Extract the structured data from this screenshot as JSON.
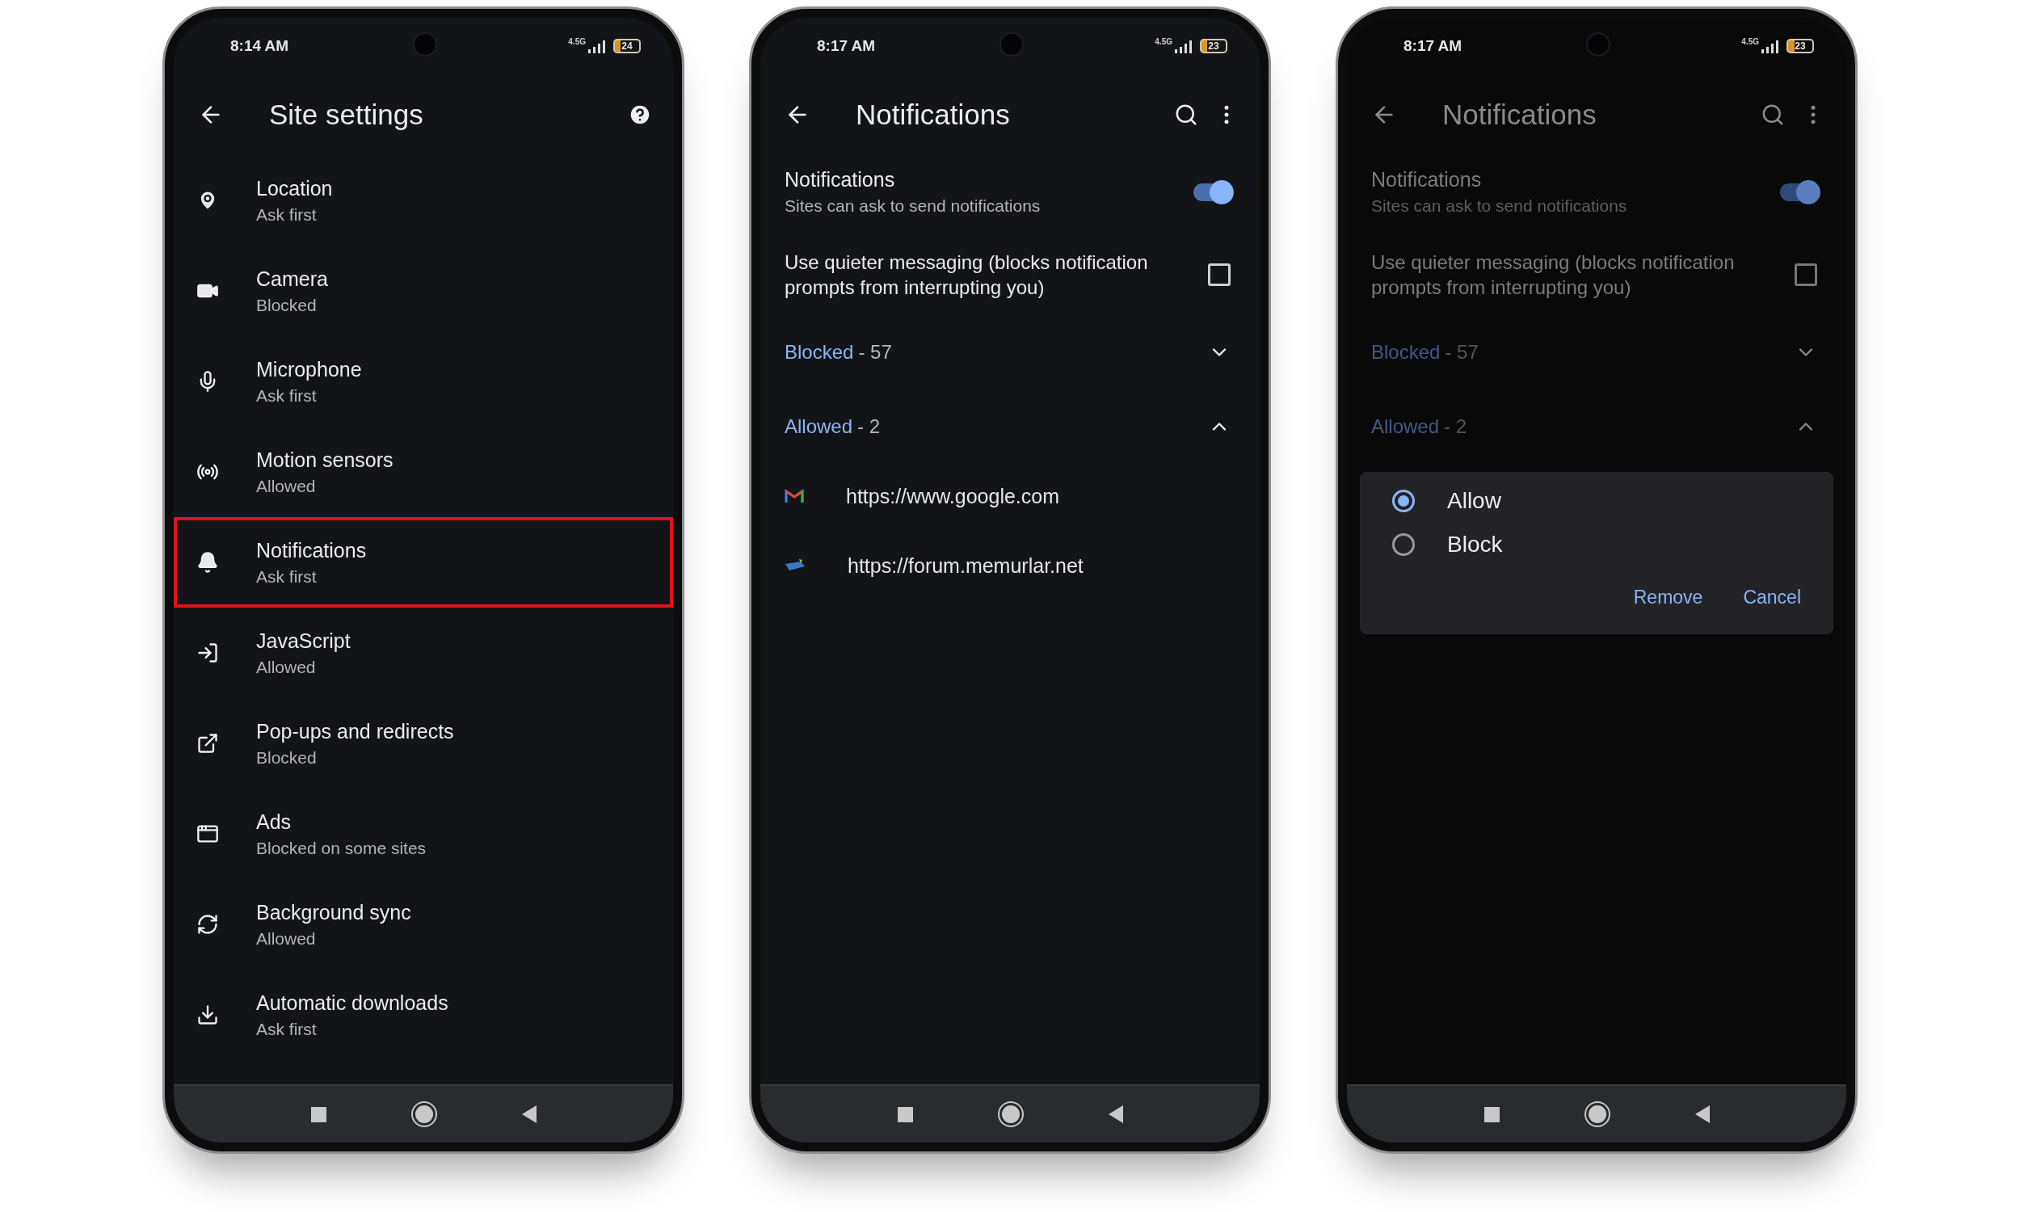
{
  "phones": [
    {
      "kind": "site_settings",
      "status": {
        "time": "8:14 AM",
        "network": "4.5G",
        "battery": "24"
      },
      "title": "Site settings",
      "items": [
        {
          "label": "Location",
          "value": "Ask first",
          "highlighted": false
        },
        {
          "label": "Camera",
          "value": "Blocked",
          "highlighted": false
        },
        {
          "label": "Microphone",
          "value": "Ask first",
          "highlighted": false
        },
        {
          "label": "Motion sensors",
          "value": "Allowed",
          "highlighted": false
        },
        {
          "label": "Notifications",
          "value": "Ask first",
          "highlighted": true
        },
        {
          "label": "JavaScript",
          "value": "Allowed",
          "highlighted": false
        },
        {
          "label": "Pop-ups and redirects",
          "value": "Blocked",
          "highlighted": false
        },
        {
          "label": "Ads",
          "value": "Blocked on some sites",
          "highlighted": false
        },
        {
          "label": "Background sync",
          "value": "Allowed",
          "highlighted": false
        },
        {
          "label": "Automatic downloads",
          "value": "Ask first",
          "highlighted": false
        }
      ]
    },
    {
      "kind": "notifications",
      "dimmed": false,
      "status": {
        "time": "8:17 AM",
        "network": "4.5G",
        "battery": "23"
      },
      "title": "Notifications",
      "toggle": {
        "label": "Notifications",
        "description": "Sites can ask to send notifications",
        "on": true
      },
      "quiet": {
        "label": "Use quieter messaging (blocks notification prompts from interrupting you)",
        "checked": false
      },
      "sections": [
        {
          "label": "Blocked",
          "count": "- 57",
          "expanded": false
        },
        {
          "label": "Allowed",
          "count": "- 2",
          "expanded": true
        }
      ],
      "sites": [
        {
          "url": "https://www.google.com"
        },
        {
          "url": "https://forum.memurlar.net"
        }
      ]
    },
    {
      "kind": "notifications",
      "dimmed": true,
      "status": {
        "time": "8:17 AM",
        "network": "4.5G",
        "battery": "23"
      },
      "title": "Notifications",
      "toggle": {
        "label": "Notifications",
        "description": "Sites can ask to send notifications",
        "on": true
      },
      "quiet": {
        "label": "Use quieter messaging (blocks notification prompts from interrupting you)",
        "checked": false
      },
      "sections": [
        {
          "label": "Blocked",
          "count": "- 57",
          "expanded": false
        },
        {
          "label": "Allowed",
          "count": "- 2",
          "expanded": true
        }
      ],
      "dialog": {
        "options": [
          {
            "label": "Allow",
            "selected": true
          },
          {
            "label": "Block",
            "selected": false
          }
        ],
        "buttons": [
          "Remove",
          "Cancel"
        ]
      }
    }
  ]
}
